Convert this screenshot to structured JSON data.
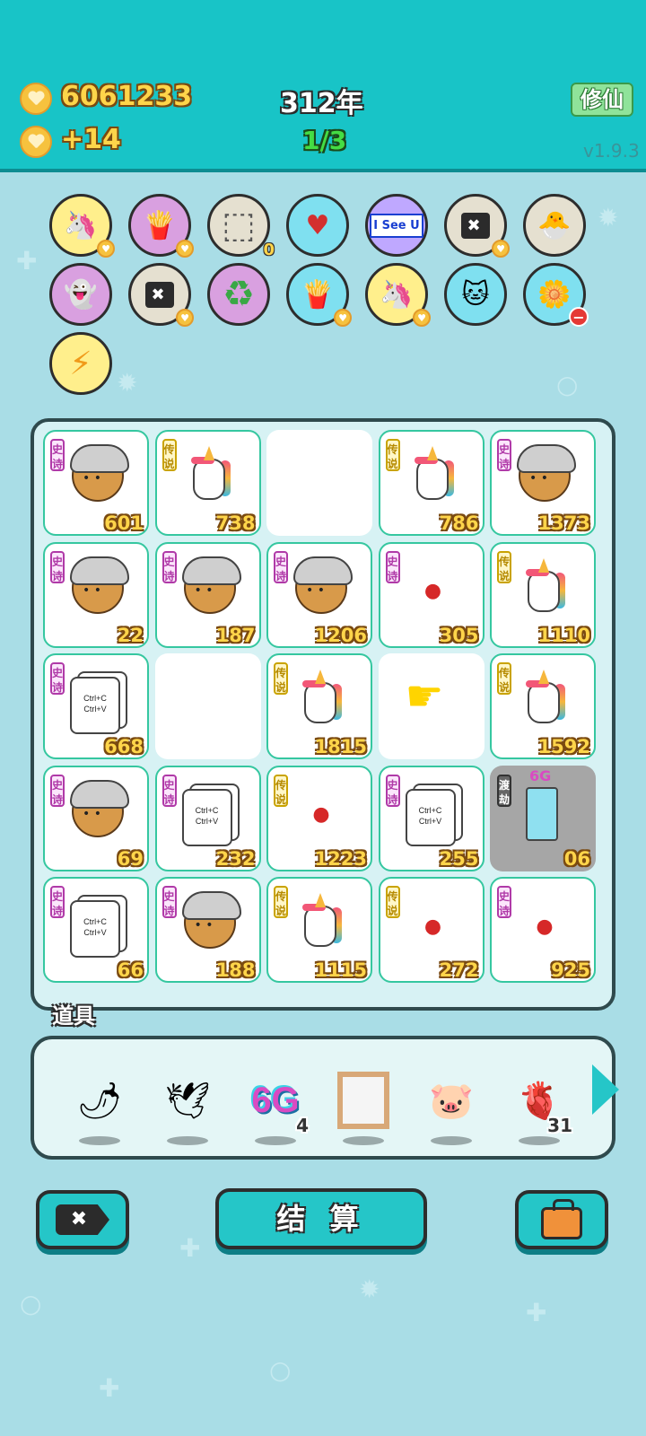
{
  "header": {
    "coins": "6061233",
    "income": "+14",
    "year": "312年",
    "progress": "1/3",
    "cultivate_button": "修仙",
    "version": "v1.9.3"
  },
  "buffs": [
    {
      "icon": "unicorn-icon",
      "glyph": "🦄",
      "bg": "#ffef8c",
      "sub": "♥"
    },
    {
      "icon": "fries-icon",
      "glyph": "🍟",
      "bg": "#d9a0e0",
      "sub": "♥"
    },
    {
      "icon": "egg-tray-icon",
      "glyph": "⬚",
      "bg": "#e5e0d0",
      "count": "0"
    },
    {
      "icon": "blood-bag-icon",
      "glyph": "♥",
      "bg": "#7fe0f0"
    },
    {
      "icon": "i-see-u-sign-icon",
      "glyph": "I See U",
      "bg": "#bfa8ff"
    },
    {
      "icon": "close-tag-icon",
      "glyph": "✖",
      "bg": "#e5e0d0",
      "sub": "♥"
    },
    {
      "icon": "chick-egg-icon",
      "glyph": "🐣",
      "bg": "#e5e0d0"
    },
    {
      "icon": "ghost-icon",
      "glyph": "👻",
      "bg": "#d9a0e0"
    },
    {
      "icon": "close-tag-icon",
      "glyph": "✖",
      "bg": "#e5e0d0",
      "sub": "♥"
    },
    {
      "icon": "recycle-icon",
      "glyph": "♻",
      "bg": "#d9a0e0"
    },
    {
      "icon": "fries-icon",
      "glyph": "🍟",
      "bg": "#7fe0f0",
      "sub": "♥"
    },
    {
      "icon": "unicorn-icon",
      "glyph": "🦄",
      "bg": "#ffef8c",
      "sub": "♥"
    },
    {
      "icon": "cool-cat-icon",
      "glyph": "🐱",
      "bg": "#7fe0f0"
    },
    {
      "icon": "potted-flower-icon",
      "glyph": "🌼",
      "bg": "#7fe0f0",
      "minus": "−"
    },
    {
      "icon": "lightning-icon",
      "glyph": "⚡",
      "bg": "#ffef8c"
    }
  ],
  "tiles": [
    {
      "type": "chicken",
      "badge": "史诗",
      "badge_class": "epic",
      "value": "601"
    },
    {
      "type": "unicorn",
      "badge": "传说",
      "badge_class": "legend",
      "value": "738"
    },
    {
      "type": "empty"
    },
    {
      "type": "unicorn",
      "badge": "传说",
      "badge_class": "legend",
      "value": "786"
    },
    {
      "type": "chicken",
      "badge": "史诗",
      "badge_class": "epic",
      "value": "1373"
    },
    {
      "type": "chicken",
      "badge": "史诗",
      "badge_class": "epic",
      "value": "22"
    },
    {
      "type": "chicken",
      "badge": "史诗",
      "badge_class": "epic",
      "value": "187"
    },
    {
      "type": "chicken",
      "badge": "史诗",
      "badge_class": "epic",
      "value": "1206"
    },
    {
      "type": "berry",
      "badge": "史诗",
      "badge_class": "epic",
      "value": "305"
    },
    {
      "type": "unicorn",
      "badge": "传说",
      "badge_class": "legend",
      "value": "1110"
    },
    {
      "type": "ctrl",
      "badge": "史诗",
      "badge_class": "epic",
      "value": "668"
    },
    {
      "type": "empty"
    },
    {
      "type": "unicorn",
      "badge": "传说",
      "badge_class": "legend",
      "value": "1815"
    },
    {
      "type": "pointer"
    },
    {
      "type": "unicorn",
      "badge": "传说",
      "badge_class": "legend",
      "value": "1592"
    },
    {
      "type": "chicken",
      "badge": "史诗",
      "badge_class": "epic",
      "value": "69"
    },
    {
      "type": "ctrl",
      "badge": "史诗",
      "badge_class": "epic",
      "value": "232"
    },
    {
      "type": "berry",
      "badge": "传说",
      "badge_class": "legend",
      "value": "1223"
    },
    {
      "type": "ctrl",
      "badge": "史诗",
      "badge_class": "epic",
      "value": "255"
    },
    {
      "type": "fridge",
      "badge": "渡劫",
      "badge_class": "dujie",
      "value": "06",
      "extra": "6G"
    },
    {
      "type": "ctrl",
      "badge": "史诗",
      "badge_class": "epic",
      "value": "66"
    },
    {
      "type": "chicken",
      "badge": "史诗",
      "badge_class": "epic",
      "value": "188"
    },
    {
      "type": "unicorn",
      "badge": "传说",
      "badge_class": "legend",
      "value": "1115"
    },
    {
      "type": "berry",
      "badge": "传说",
      "badge_class": "legend",
      "value": "272"
    },
    {
      "type": "berry",
      "badge": "史诗",
      "badge_class": "epic",
      "value": "925"
    }
  ],
  "ctrl_text": {
    "line1": "Ctrl+C",
    "line2": "Ctrl+V"
  },
  "items": {
    "label": "道具",
    "list": [
      {
        "icon": "chili-pepper-icon",
        "glyph": "🌶"
      },
      {
        "icon": "white-bird-icon",
        "glyph": "🕊"
      },
      {
        "icon": "6g-icon",
        "glyph": "6G",
        "qty": "4"
      },
      {
        "icon": "picture-frame-icon",
        "glyph": ""
      },
      {
        "icon": "piggy-bank-icon",
        "glyph": "🐷"
      },
      {
        "icon": "liver-icon",
        "glyph": "🫀",
        "qty": "31"
      }
    ]
  },
  "footer": {
    "settle": "结 算",
    "close_glyph": "✖"
  },
  "colors": {
    "header": "#18c4c7",
    "background": "#a9dde6",
    "tile_border": "#35c7a0",
    "value_text": "#ffd54a"
  }
}
